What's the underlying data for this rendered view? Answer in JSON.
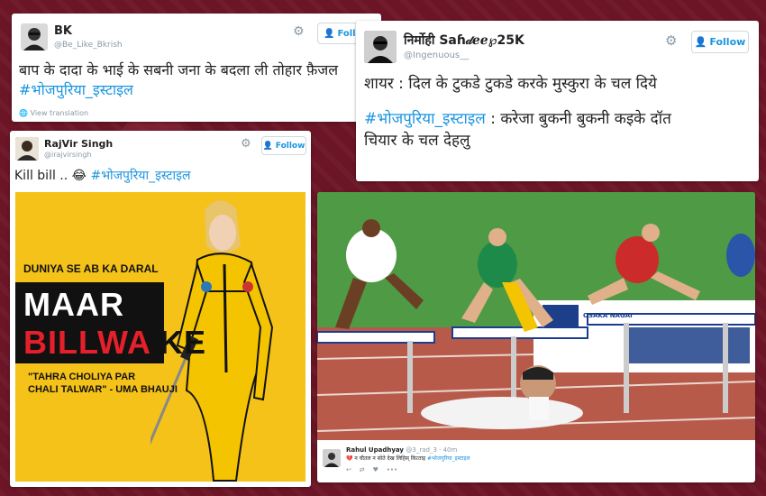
{
  "tweet_bk": {
    "name": "BK",
    "handle": "@Be_Like_Bkrish",
    "follow": "Follow",
    "text_main": "बाप के दादा के भाई के सबनी जना के बदला ली तोहार फ़ैजल",
    "hashtag": "#भोजपुरिया_इस्टाइल",
    "view_translation": "View translation"
  },
  "tweet_nirmohi": {
    "name": "निर्मोही Saɦ𝒹ℯℯ℘25K",
    "handle": "@Ingenuous__",
    "follow": "Follow",
    "line1": "शायर : दिल के  टुकडे टुकडे करके मुस्कुरा के चल दिये",
    "hashtag": "#भोजपुरिया_इस्टाइल",
    "line2_rest": " : करेजा बुकनी बुकनी कइके दॉत",
    "line3": "चियार के चल देहलु"
  },
  "tweet_rajvir": {
    "name": "RajVir Singh",
    "handle": "@irajvirsingh",
    "follow": "Follow",
    "text": "Kill bill .. 😂 ",
    "hashtag": "#भोजपुरिया_इस्टाइल",
    "poster": {
      "top_line": "DUNIYA SE AB KA DARAL",
      "line_maar": "MAAR",
      "line_billwa": "BILLWA",
      "line_ke": "KE",
      "quote1": "\"TAHRA CHOLIYA PAR",
      "quote2": "CHALI TALWAR\" - UMA BHAUJI"
    }
  },
  "tweet_rahul": {
    "name": "Rahul Upadhyay",
    "handle": "@3_rad_3 · 40m",
    "text": "💔 न चीतल न सोते देख लिहिस् कित्‍ताइ",
    "hashtag": "#भोजपुरिया_इस्टाइल",
    "banner_text": "OSAKA NAGAI"
  },
  "colors": {
    "background": "#6b1526",
    "link": "#1b95e0",
    "poster_yellow": "#f5c219",
    "poster_red": "#e5202a"
  }
}
